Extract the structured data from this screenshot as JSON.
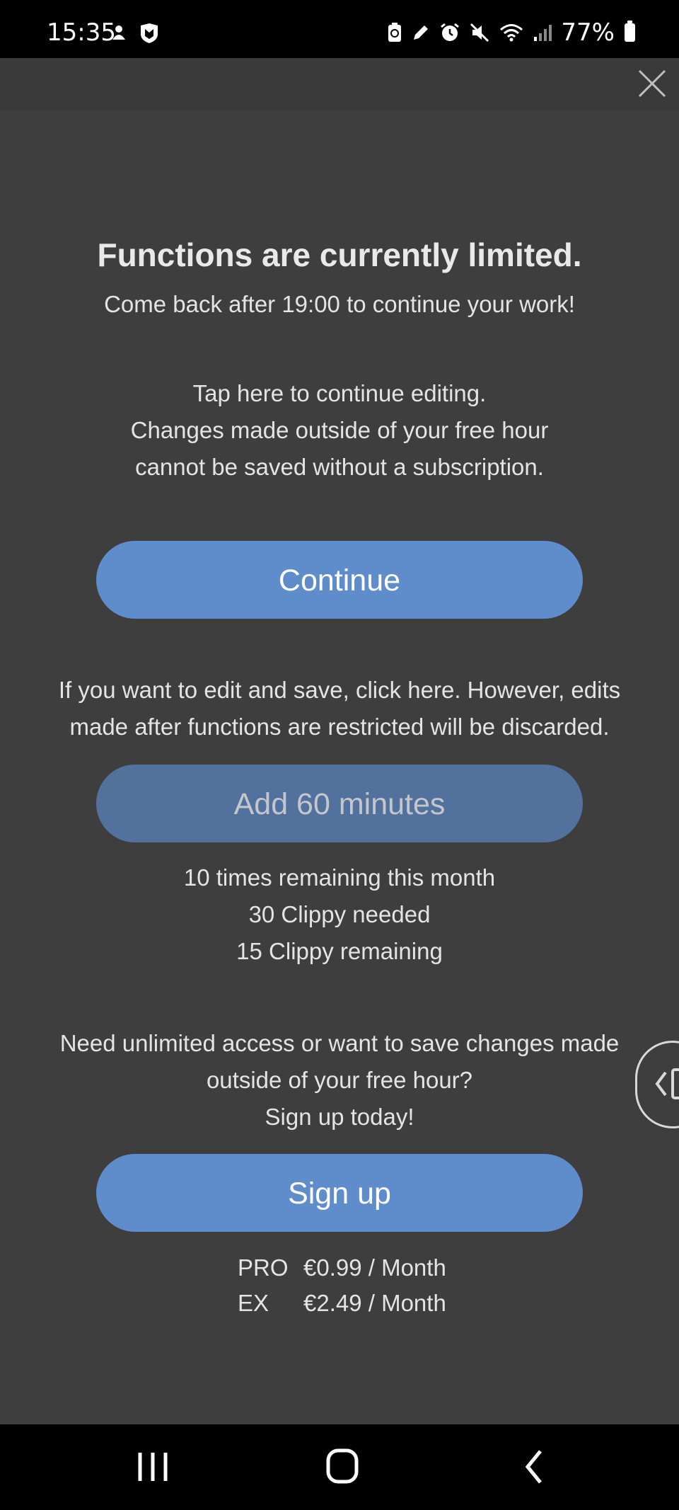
{
  "status_bar": {
    "time": "15:35",
    "battery_percent": "77%",
    "left_icons": [
      "notification-icon",
      "mcafee-shield-icon"
    ],
    "right_icons": [
      "recycle-battery-icon",
      "pen-icon",
      "alarm-icon",
      "mute-icon",
      "wifi-icon",
      "signal-icon"
    ]
  },
  "dialog": {
    "title": "Functions are currently limited.",
    "subtitle": "Come back after 19:00 to continue your work!",
    "continue_info": [
      "Tap here to continue editing.",
      "Changes made outside of your free hour",
      "cannot be saved without a subscription."
    ],
    "continue_button": "Continue",
    "edit_info": [
      "If you want to edit and save, click here. However, edits",
      "made after functions are restricted will be discarded."
    ],
    "add_button": "Add 60 minutes",
    "remaining": [
      "10 times remaining this month",
      "30 Clippy needed",
      "15 Clippy remaining"
    ],
    "signup_info": [
      "Need unlimited access or want to save changes made",
      "outside of your free hour?",
      "Sign up today!"
    ],
    "signup_button": "Sign up",
    "pricing": [
      {
        "plan": "PRO",
        "price": "€0.99 / Month"
      },
      {
        "plan": "EX",
        "price": "€2.49 / Month"
      }
    ]
  },
  "colors": {
    "background": "#3e3e3f",
    "primary_button": "#5f8ccb",
    "disabled_button": "#52719c",
    "status_bar": "#000000"
  }
}
